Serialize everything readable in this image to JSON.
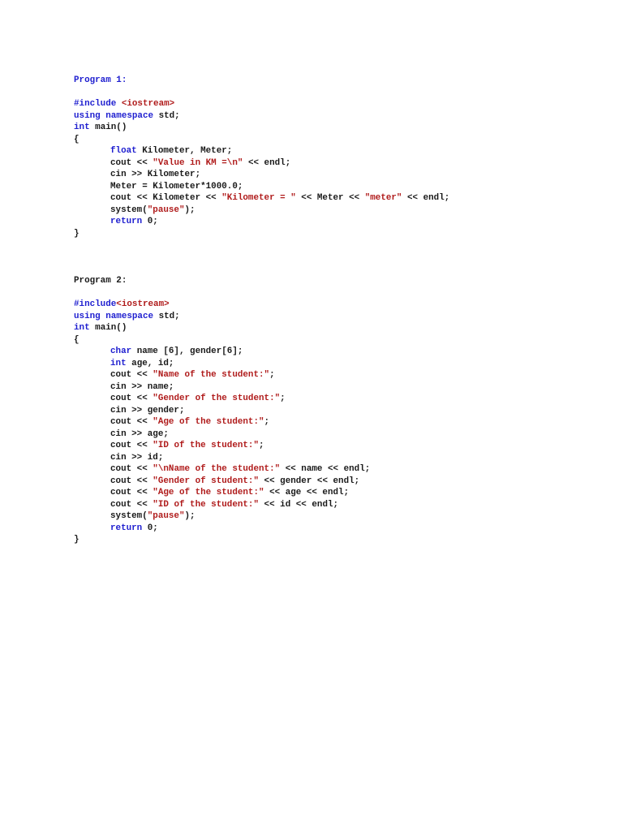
{
  "colors": {
    "keyword": "#2020d0",
    "string": "#b01c1c",
    "text": "#1a1a1a"
  },
  "programs": [
    {
      "title": "Program 1:",
      "title_style": "blue",
      "lines": [
        {
          "indent": false,
          "tokens": [
            [
              "#include ",
              "kw"
            ],
            [
              "<iostream>",
              "str"
            ]
          ]
        },
        {
          "indent": false,
          "tokens": [
            [
              "using namespace ",
              "kw"
            ],
            [
              "std;",
              "plain"
            ]
          ]
        },
        {
          "indent": false,
          "tokens": [
            [
              "int ",
              "kw"
            ],
            [
              "main()",
              "plain"
            ]
          ]
        },
        {
          "indent": false,
          "tokens": [
            [
              "{",
              "plain"
            ]
          ]
        },
        {
          "indent": true,
          "tokens": [
            [
              "float ",
              "kw"
            ],
            [
              "Kilometer, Meter;",
              "plain"
            ]
          ]
        },
        {
          "indent": true,
          "tokens": [
            [
              "cout << ",
              "plain"
            ],
            [
              "\"Value in KM =\\n\"",
              "str"
            ],
            [
              " << endl;",
              "plain"
            ]
          ]
        },
        {
          "indent": true,
          "tokens": [
            [
              "cin >> Kilometer;",
              "plain"
            ]
          ]
        },
        {
          "indent": true,
          "tokens": [
            [
              "Meter = Kilometer*1000.0;",
              "plain"
            ]
          ]
        },
        {
          "indent": true,
          "tokens": [
            [
              "cout << Kilometer << ",
              "plain"
            ],
            [
              "\"Kilometer = \"",
              "str"
            ],
            [
              " << Meter << ",
              "plain"
            ],
            [
              "\"meter\"",
              "str"
            ],
            [
              " << endl;",
              "plain"
            ]
          ]
        },
        {
          "indent": true,
          "tokens": [
            [
              "system(",
              "plain"
            ],
            [
              "\"pause\"",
              "str"
            ],
            [
              ");",
              "plain"
            ]
          ]
        },
        {
          "indent": true,
          "tokens": [
            [
              "return ",
              "kw"
            ],
            [
              "0;",
              "plain"
            ]
          ]
        },
        {
          "indent": false,
          "tokens": [
            [
              "}",
              "plain"
            ]
          ]
        }
      ]
    },
    {
      "title": "Program 2:",
      "title_style": "black",
      "lines": [
        {
          "indent": false,
          "tokens": [
            [
              "#include",
              "kw"
            ],
            [
              "<iostream>",
              "str"
            ]
          ]
        },
        {
          "indent": false,
          "tokens": [
            [
              "using namespace ",
              "kw"
            ],
            [
              "std;",
              "plain"
            ]
          ]
        },
        {
          "indent": false,
          "tokens": [
            [
              "int ",
              "kw"
            ],
            [
              "main()",
              "plain"
            ]
          ]
        },
        {
          "indent": false,
          "tokens": [
            [
              "{",
              "plain"
            ]
          ]
        },
        {
          "indent": true,
          "tokens": [
            [
              "char ",
              "kw"
            ],
            [
              "name [6], gender[6];",
              "plain"
            ]
          ]
        },
        {
          "indent": true,
          "tokens": [
            [
              "int ",
              "kw"
            ],
            [
              "age, id;",
              "plain"
            ]
          ]
        },
        {
          "indent": true,
          "tokens": [
            [
              "cout << ",
              "plain"
            ],
            [
              "\"Name of the student:\"",
              "str"
            ],
            [
              ";",
              "plain"
            ]
          ]
        },
        {
          "indent": true,
          "tokens": [
            [
              "cin >> name;",
              "plain"
            ]
          ]
        },
        {
          "indent": true,
          "tokens": [
            [
              "cout << ",
              "plain"
            ],
            [
              "\"Gender of the student:\"",
              "str"
            ],
            [
              ";",
              "plain"
            ]
          ]
        },
        {
          "indent": true,
          "tokens": [
            [
              "cin >> gender;",
              "plain"
            ]
          ]
        },
        {
          "indent": true,
          "tokens": [
            [
              "cout << ",
              "plain"
            ],
            [
              "\"Age of the student:\"",
              "str"
            ],
            [
              ";",
              "plain"
            ]
          ]
        },
        {
          "indent": true,
          "tokens": [
            [
              "cin >> age;",
              "plain"
            ]
          ]
        },
        {
          "indent": true,
          "tokens": [
            [
              "cout << ",
              "plain"
            ],
            [
              "\"ID of the student:\"",
              "str"
            ],
            [
              ";",
              "plain"
            ]
          ]
        },
        {
          "indent": true,
          "tokens": [
            [
              "cin >> id;",
              "plain"
            ]
          ]
        },
        {
          "indent": true,
          "tokens": [
            [
              "cout << ",
              "plain"
            ],
            [
              "\"\\nName of the student:\"",
              "str"
            ],
            [
              " << name << endl;",
              "plain"
            ]
          ]
        },
        {
          "indent": true,
          "tokens": [
            [
              "cout << ",
              "plain"
            ],
            [
              "\"Gender of student:\"",
              "str"
            ],
            [
              " << gender << endl;",
              "plain"
            ]
          ]
        },
        {
          "indent": true,
          "tokens": [
            [
              "cout << ",
              "plain"
            ],
            [
              "\"Age of the student:\"",
              "str"
            ],
            [
              " << age << endl;",
              "plain"
            ]
          ]
        },
        {
          "indent": true,
          "tokens": [
            [
              "cout << ",
              "plain"
            ],
            [
              "\"ID of the student:\"",
              "str"
            ],
            [
              " << id << endl;",
              "plain"
            ]
          ]
        },
        {
          "indent": true,
          "tokens": [
            [
              "system(",
              "plain"
            ],
            [
              "\"pause\"",
              "str"
            ],
            [
              ");",
              "plain"
            ]
          ]
        },
        {
          "indent": true,
          "tokens": [
            [
              "return ",
              "kw"
            ],
            [
              "0;",
              "plain"
            ]
          ]
        },
        {
          "indent": false,
          "tokens": [
            [
              "}",
              "plain"
            ]
          ]
        }
      ]
    }
  ]
}
